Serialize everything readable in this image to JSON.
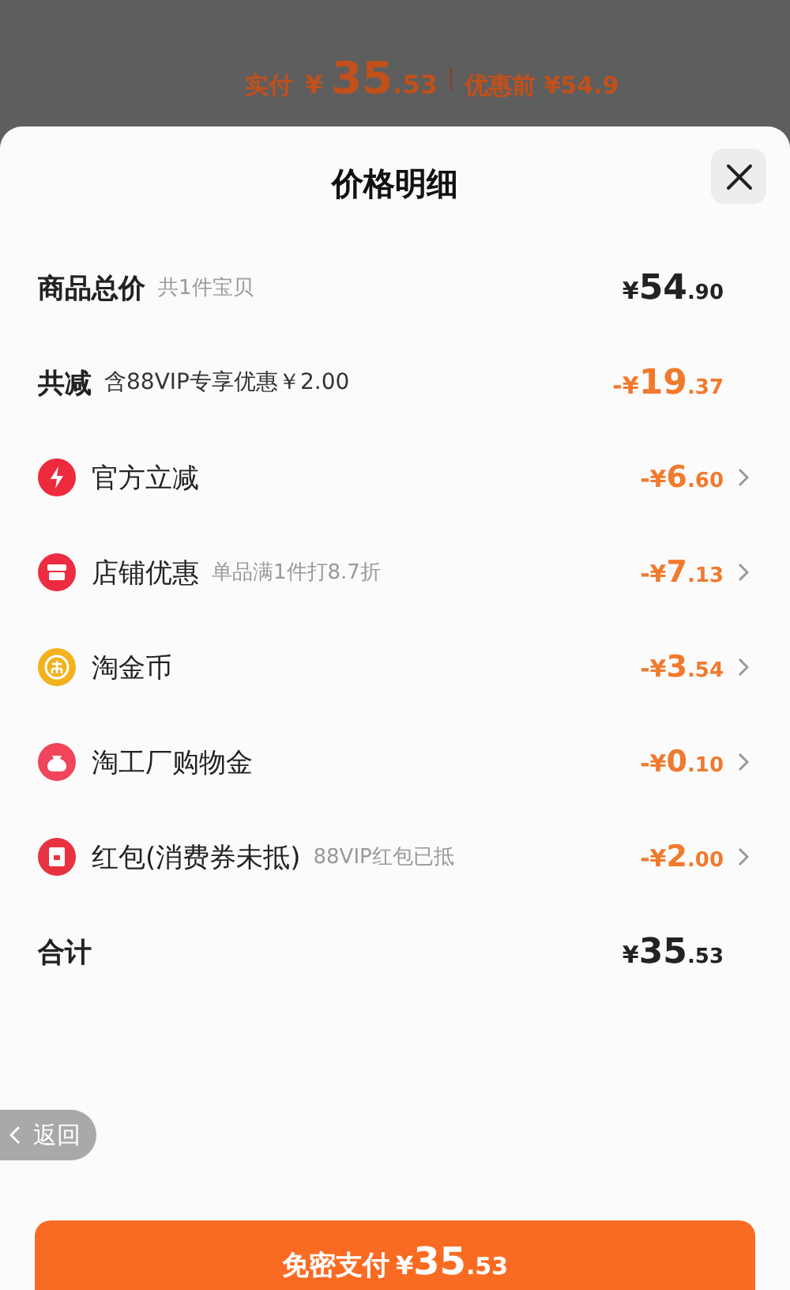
{
  "backdrop": {
    "paid_label": "实付",
    "paid_price": {
      "sign": "¥",
      "whole": "35",
      "fraction": ".53"
    },
    "before_label": "优惠前",
    "before_price": "¥54.9"
  },
  "sheet": {
    "title": "价格明细",
    "rows": [
      {
        "kind": "total",
        "label": "商品总价",
        "note": "共1件宝贝",
        "price": {
          "sign": "¥",
          "whole": "54",
          "fraction": ".90"
        }
      },
      {
        "kind": "reduction",
        "label": "共减",
        "note": "含88VIP专享优惠￥2.00",
        "price": {
          "sign": "-¥",
          "whole": "19",
          "fraction": ".37"
        }
      },
      {
        "kind": "item",
        "label": "官方立减",
        "price": {
          "sign": "-¥",
          "whole": "6",
          "fraction": ".60"
        }
      },
      {
        "kind": "item",
        "label": "店铺优惠",
        "note": "单品满1件打8.7折",
        "price": {
          "sign": "-¥",
          "whole": "7",
          "fraction": ".13"
        }
      },
      {
        "kind": "item",
        "label": "淘金币",
        "price": {
          "sign": "-¥",
          "whole": "3",
          "fraction": ".54"
        }
      },
      {
        "kind": "item",
        "label": "淘工厂购物金",
        "price": {
          "sign": "-¥",
          "whole": "0",
          "fraction": ".10"
        }
      },
      {
        "kind": "item",
        "label": "红包(消费券未抵)",
        "note": "88VIP红包已抵",
        "price": {
          "sign": "-¥",
          "whole": "2",
          "fraction": ".00"
        }
      },
      {
        "kind": "total",
        "label": "合计",
        "price": {
          "sign": "¥",
          "whole": "35",
          "fraction": ".53"
        }
      }
    ],
    "back_button": "返回",
    "pay_button": {
      "label": "免密支付",
      "price": {
        "sign": "¥",
        "whole": "35",
        "fraction": ".53"
      }
    }
  }
}
